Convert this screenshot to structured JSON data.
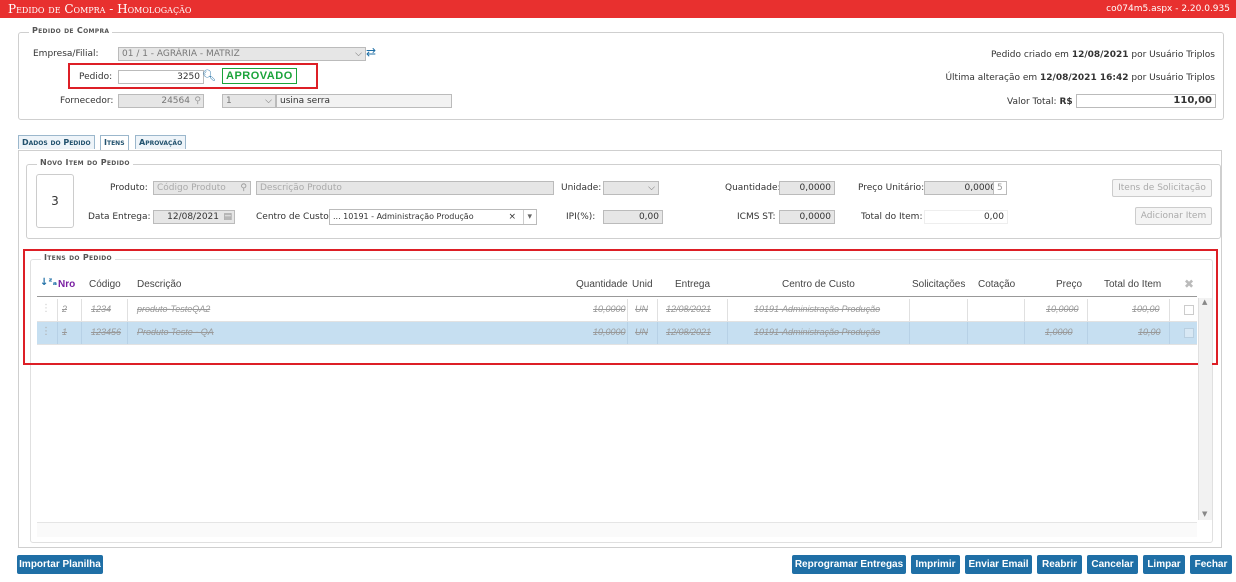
{
  "window": {
    "title": "Pedido de Compra  - Homologação",
    "version": "co074m5.aspx - 2.20.0.935"
  },
  "header": {
    "legend": "Pedido de Compra",
    "empresa_label": "Empresa/Filial:",
    "empresa_value": "01 / 1 - AGRÁRIA - MATRIZ",
    "pedido_label": "Pedido:",
    "pedido_value": "3250",
    "status": "APROVADO",
    "fornecedor_label": "Fornecedor:",
    "fornecedor_code": "24564",
    "fornecedor_loja": "1",
    "fornecedor_name": "usina serra",
    "criado_prefix": "Pedido criado em",
    "criado_date": "12/08/2021",
    "criado_suffix": "por Usuário Triplos",
    "alterado_prefix": "Última alteração em",
    "alterado_date": "12/08/2021 16:42",
    "alterado_suffix": "por Usuário Triplos",
    "valor_label": "Valor Total:",
    "valor_currency": "R$",
    "valor_value": "110,00"
  },
  "tabs": [
    {
      "label": "Dados do Pedido"
    },
    {
      "label": "Itens"
    },
    {
      "label": "Aprovação"
    }
  ],
  "novo_item": {
    "legend": "Novo Item do Pedido",
    "seq": "3",
    "produto_label": "Produto:",
    "produto_placeholder": "Código Produto",
    "descricao_placeholder": "Descrição Produto",
    "unidade_label": "Unidade:",
    "quantidade_label": "Quantidade:",
    "quantidade_value": "0,0000",
    "preco_label": "Preço Unitário:",
    "preco_value": "0,0000",
    "preco_suffix": "5",
    "data_label": "Data Entrega:",
    "data_value": "12/08/2021",
    "centro_label": "Centro de Custo:",
    "centro_value": "... 10191 - Administração Produção",
    "ipi_label": "IPI(%):",
    "ipi_value": "0,00",
    "icms_label": "ICMS ST:",
    "icms_value": "0,0000",
    "total_label": "Total do Item:",
    "total_value": "0,00",
    "btn_solicitacao": "Itens de Solicitação",
    "btn_adicionar": "Adicionar Item"
  },
  "itens": {
    "legend": "Itens do Pedido",
    "columns": {
      "nro": "Nro",
      "codigo": "Código",
      "descricao": "Descrição",
      "quantidade": "Quantidade",
      "unid": "Unid",
      "entrega": "Entrega",
      "centro": "Centro de Custo",
      "solicitacoes": "Solicitações",
      "cotacao": "Cotação",
      "preco": "Preço",
      "total": "Total do Item"
    },
    "rows": [
      {
        "nro": "2",
        "codigo": "1234",
        "descricao": "produto-TesteQA2",
        "quantidade": "10,0000",
        "unid": "UN",
        "entrega": "12/08/2021",
        "centro": "10191-Administração Produção",
        "preco": "10,0000",
        "total": "100,00"
      },
      {
        "nro": "1",
        "codigo": "123456",
        "descricao": "Produto Teste - QA",
        "quantidade": "10,0000",
        "unid": "UN",
        "entrega": "12/08/2021",
        "centro": "10191-Administração Produção",
        "preco": "1,0000",
        "total": "10,00"
      }
    ]
  },
  "footer": {
    "importar": "Importar Planilha",
    "reprogramar": "Reprogramar Entregas",
    "imprimir": "Imprimir",
    "email": "Enviar Email",
    "reabrir": "Reabrir",
    "cancelar": "Cancelar",
    "limpar": "Limpar",
    "fechar": "Fechar"
  },
  "colors": {
    "titlebar": "#e8302f",
    "button": "#1f6fa6",
    "approved": "#1aa33a",
    "highlight": "#c6dff1",
    "annotation": "#dd1f26"
  }
}
